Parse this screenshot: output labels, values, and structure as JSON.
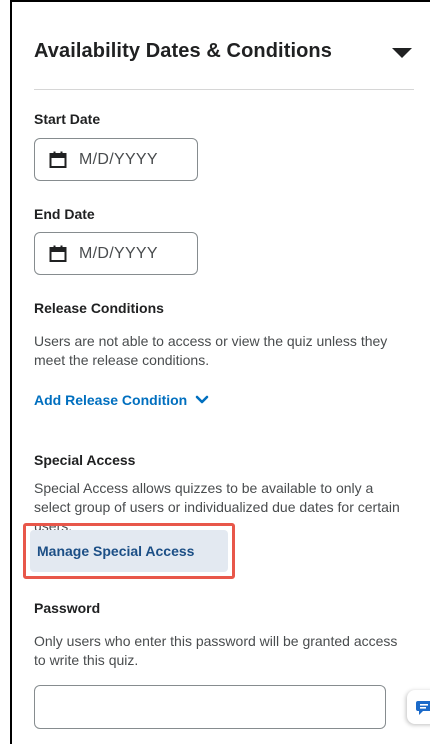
{
  "section": {
    "title": "Availability Dates & Conditions"
  },
  "start_date": {
    "label": "Start Date",
    "placeholder": "M/D/YYYY"
  },
  "end_date": {
    "label": "End Date",
    "placeholder": "M/D/YYYY"
  },
  "release_conditions": {
    "label": "Release Conditions",
    "description": "Users are not able to access or view the quiz unless they meet the release conditions.",
    "add_link": "Add Release Condition"
  },
  "special_access": {
    "label": "Special Access",
    "description": "Special Access allows quizzes to be available to only a select group of users or individualized due dates for certain users.",
    "manage_button": "Manage Special Access"
  },
  "password": {
    "label": "Password",
    "description": "Only users who enter this password will be granted access to write this quiz.",
    "value": ""
  },
  "icons": {
    "collapse": "caret-down-icon",
    "calendar": "calendar-icon",
    "add_chevron": "chevron-down-icon",
    "chat": "chat-icon"
  },
  "colors": {
    "link": "#006fbf",
    "highlight": "#e8574a",
    "button_bg": "#e3e9f1",
    "chat_icon": "#1b6ac9"
  }
}
